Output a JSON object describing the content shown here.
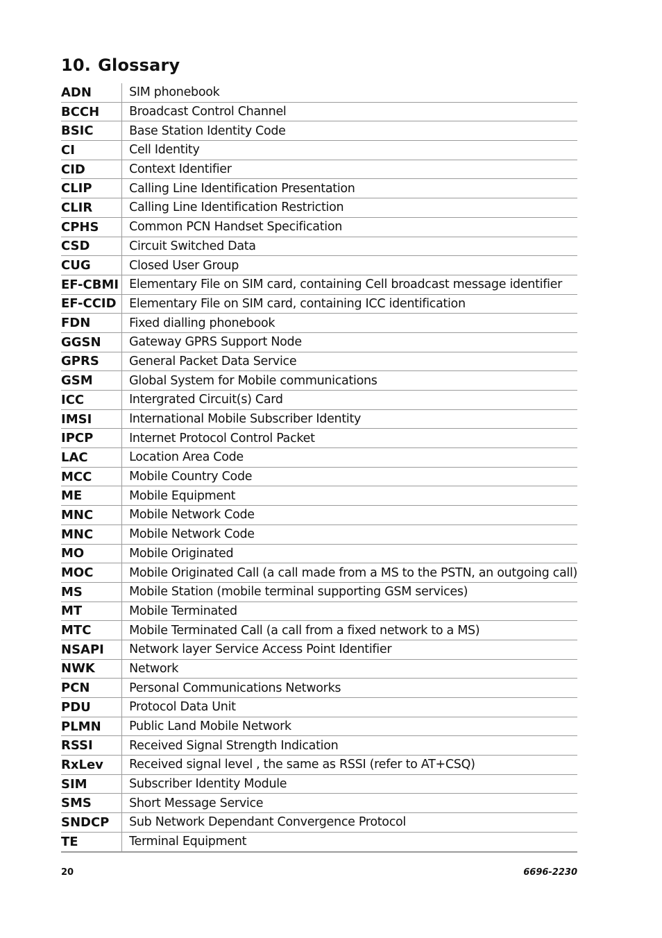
{
  "heading": {
    "number": "10.",
    "title": "Glossary"
  },
  "glossary": [
    {
      "term": "ADN",
      "definition": "SIM phonebook"
    },
    {
      "term": "BCCH",
      "definition": "Broadcast Control Channel"
    },
    {
      "term": "BSIC",
      "definition": "Base Station Identity Code"
    },
    {
      "term": "CI",
      "definition": "Cell Identity"
    },
    {
      "term": "CID",
      "definition": "Context Identifier"
    },
    {
      "term": "CLIP",
      "definition": "Calling Line Identification Presentation"
    },
    {
      "term": "CLIR",
      "definition": "Calling Line Identification Restriction"
    },
    {
      "term": "CPHS",
      "definition": "Common PCN Handset Specification"
    },
    {
      "term": "CSD",
      "definition": "Circuit Switched Data"
    },
    {
      "term": "CUG",
      "definition": "Closed User Group"
    },
    {
      "term": "EF-CBMI",
      "definition": "Elementary File on SIM card, containing Cell broadcast message identifier"
    },
    {
      "term": "EF-CCID",
      "definition": "Elementary File on SIM card, containing ICC identification"
    },
    {
      "term": "FDN",
      "definition": "Fixed dialling phonebook"
    },
    {
      "term": "GGSN",
      "definition": "Gateway GPRS Support Node"
    },
    {
      "term": "GPRS",
      "definition": "General Packet Data Service"
    },
    {
      "term": "GSM",
      "definition": "Global System for Mobile communications"
    },
    {
      "term": "ICC",
      "definition": "Intergrated Circuit(s) Card"
    },
    {
      "term": "IMSI",
      "definition": "International Mobile Subscriber Identity"
    },
    {
      "term": "IPCP",
      "definition": "Internet Protocol Control Packet"
    },
    {
      "term": "LAC",
      "definition": "Location Area Code"
    },
    {
      "term": "MCC",
      "definition": "Mobile Country Code"
    },
    {
      "term": "ME",
      "definition": "Mobile Equipment"
    },
    {
      "term": "MNC",
      "definition": "Mobile Network Code"
    },
    {
      "term": "MNC",
      "definition": "Mobile Network Code"
    },
    {
      "term": "MO",
      "definition": "Mobile Originated"
    },
    {
      "term": "MOC",
      "definition": "Mobile Originated Call (a call made from a MS to the PSTN, an outgoing call)"
    },
    {
      "term": "MS",
      "definition": "Mobile Station (mobile terminal supporting GSM services)"
    },
    {
      "term": "MT",
      "definition": "Mobile Terminated"
    },
    {
      "term": "MTC",
      "definition": "Mobile Terminated Call (a call from a fixed network to a MS)"
    },
    {
      "term": "NSAPI",
      "definition": "Network layer Service Access Point Identifier"
    },
    {
      "term": "NWK",
      "definition": "Network"
    },
    {
      "term": "PCN",
      "definition": "Personal Communications Networks"
    },
    {
      "term": "PDU",
      "definition": "Protocol Data Unit"
    },
    {
      "term": "PLMN",
      "definition": "Public Land Mobile Network"
    },
    {
      "term": "RSSI",
      "definition": "Received Signal Strength Indication"
    },
    {
      "term": "RxLev",
      "definition": "Received signal level , the same as RSSI (refer to AT+CSQ)"
    },
    {
      "term": "SIM",
      "definition": "Subscriber Identity Module"
    },
    {
      "term": "SMS",
      "definition": "Short Message Service"
    },
    {
      "term": "SNDCP",
      "definition": "Sub Network Dependant Convergence Protocol"
    },
    {
      "term": "TE",
      "definition": "Terminal Equipment"
    }
  ],
  "footer": {
    "page_number": "20",
    "document_id": "6696-2230"
  }
}
